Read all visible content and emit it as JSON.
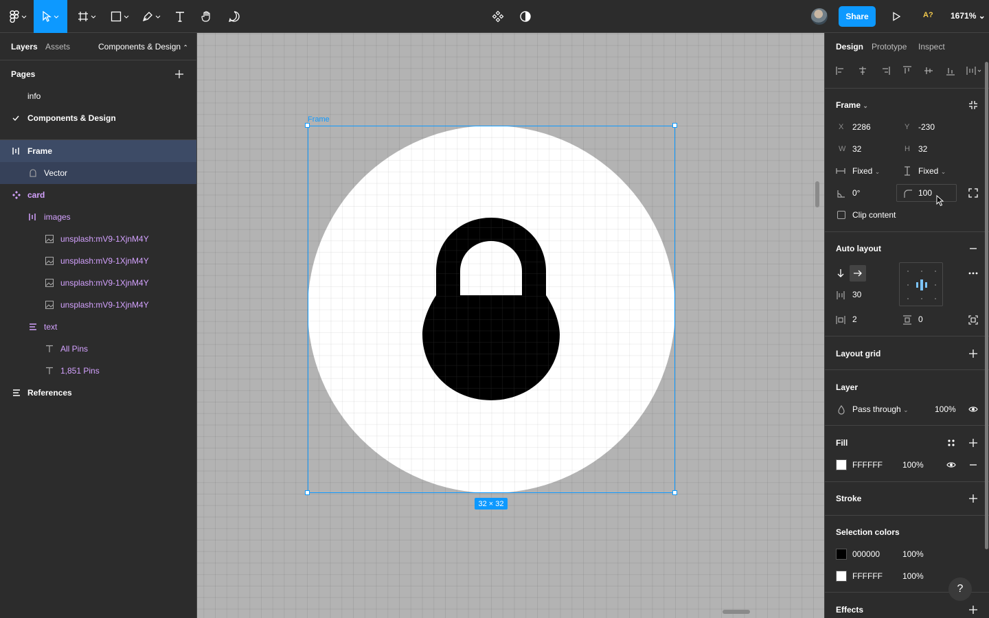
{
  "topbar": {
    "share_label": "Share",
    "avatar_badge": "A?",
    "zoom": "1671%"
  },
  "left": {
    "tabs": {
      "layers": "Layers",
      "assets": "Assets",
      "page_switch": "Components & Design"
    },
    "pages_title": "Pages",
    "pages": [
      "info",
      "Components & Design"
    ],
    "layers": [
      {
        "label": "Frame",
        "icon": "autolayout-icon"
      },
      {
        "label": "Vector",
        "icon": "vector-icon"
      },
      {
        "label": "card",
        "icon": "component-icon"
      },
      {
        "label": "images",
        "icon": "autolayout-icon"
      },
      {
        "label": "unsplash:mV9-1XjnM4Y",
        "icon": "image-icon"
      },
      {
        "label": "unsplash:mV9-1XjnM4Y",
        "icon": "image-icon"
      },
      {
        "label": "unsplash:mV9-1XjnM4Y",
        "icon": "image-icon"
      },
      {
        "label": "unsplash:mV9-1XjnM4Y",
        "icon": "image-icon"
      },
      {
        "label": "text",
        "icon": "autolayout-icon"
      },
      {
        "label": "All Pins",
        "icon": "text-icon"
      },
      {
        "label": "1,851 Pins",
        "icon": "text-icon"
      },
      {
        "label": "References",
        "icon": "autolayout-icon"
      }
    ]
  },
  "canvas": {
    "frame_label": "Frame",
    "size_badge": "32 × 32"
  },
  "right": {
    "tabs": {
      "design": "Design",
      "prototype": "Prototype",
      "inspect": "Inspect"
    },
    "frame": {
      "title": "Frame",
      "x_label": "X",
      "x": "2286",
      "y_label": "Y",
      "y": "-230",
      "w_label": "W",
      "w": "32",
      "h_label": "H",
      "h": "32",
      "horiz_resize": "Fixed",
      "vert_resize": "Fixed",
      "rotation": "0°",
      "radius": "100",
      "clip_content": "Clip content"
    },
    "auto_layout": {
      "title": "Auto layout",
      "spacing": "30",
      "padding_h": "2",
      "padding_v": "0"
    },
    "layout_grid": {
      "title": "Layout grid"
    },
    "layer": {
      "title": "Layer",
      "blend": "Pass through",
      "opacity": "100%"
    },
    "fill": {
      "title": "Fill",
      "hex": "FFFFFF",
      "opacity": "100%"
    },
    "stroke": {
      "title": "Stroke"
    },
    "selection_colors": {
      "title": "Selection colors",
      "colors": [
        {
          "hex": "000000",
          "opacity": "100%",
          "swatch": "#000000"
        },
        {
          "hex": "FFFFFF",
          "opacity": "100%",
          "swatch": "#FFFFFF"
        }
      ]
    },
    "effects": {
      "title": "Effects"
    }
  },
  "help_label": "?",
  "colors": {
    "accent": "#0d99ff",
    "panel": "#2c2c2c",
    "canvas": "#b3b3b3",
    "purple": "#d4a2ff"
  }
}
